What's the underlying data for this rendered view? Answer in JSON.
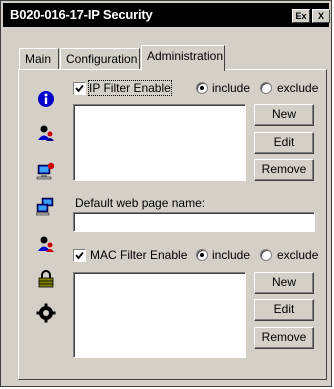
{
  "window": {
    "title": "B020-016-17-IP Security",
    "exit_glyph": "Ex",
    "close_glyph": "X"
  },
  "tabs": [
    {
      "label": "Main"
    },
    {
      "label": "Configuration"
    },
    {
      "label": "Administration",
      "active": true
    }
  ],
  "sidebar": {
    "icons": [
      "info-icon",
      "user-icon",
      "computer-alert-icon",
      "network-computers-icon",
      "user-alert-icon",
      "lock-icon",
      "settings-gear-icon"
    ]
  },
  "ip_filter": {
    "enable_label": "IP Filter Enable",
    "enabled": true,
    "include_label": "include",
    "exclude_label": "exclude",
    "mode": "include",
    "new_label": "New",
    "edit_label": "Edit",
    "remove_label": "Remove"
  },
  "default_page": {
    "label": "Default web page name:",
    "value": ""
  },
  "mac_filter": {
    "enable_label": "MAC Filter Enable",
    "enabled": true,
    "include_label": "include",
    "exclude_label": "exclude",
    "mode": "include",
    "new_label": "New",
    "edit_label": "Edit",
    "remove_label": "Remove"
  },
  "colors": {
    "face": "#d4d0c8",
    "titlebar": "#000000",
    "icon_blue": "#0000cc",
    "icon_red": "#cc0000"
  }
}
